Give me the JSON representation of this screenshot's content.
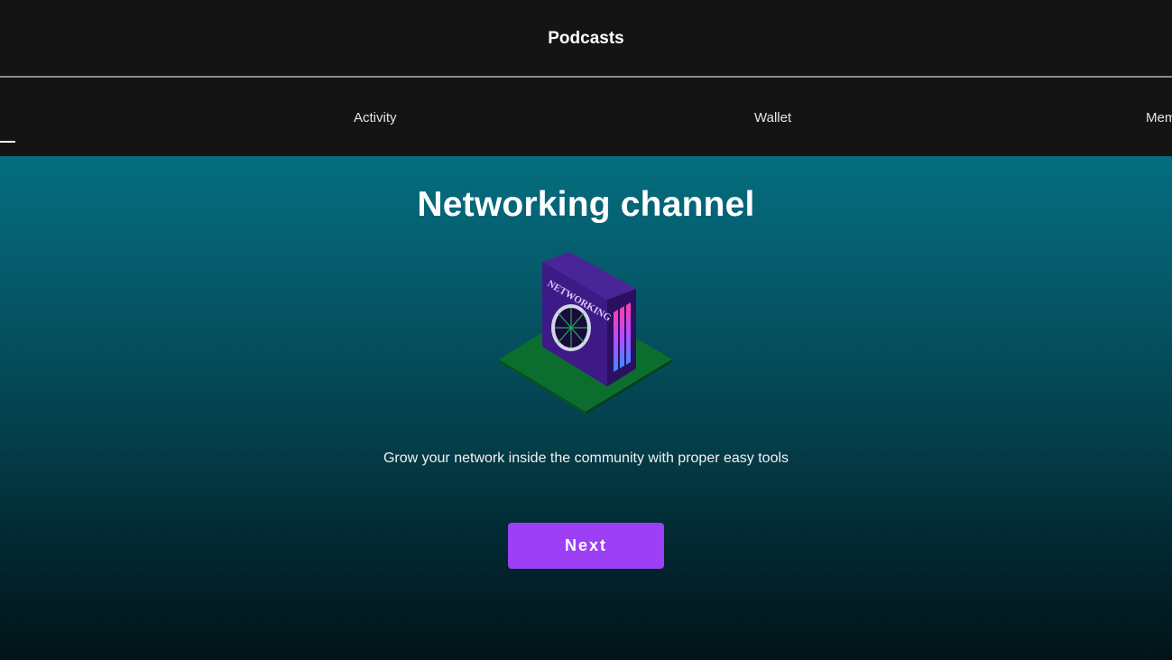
{
  "header": {
    "title": "Podcasts"
  },
  "tabs": [
    {
      "label": "Activity"
    },
    {
      "label": "Wallet"
    },
    {
      "label": "Mem"
    }
  ],
  "main": {
    "heading": "Networking channel",
    "illustration": {
      "icon": "networking-server-icon",
      "label": "NETWORKING"
    },
    "subtitle": "Grow your network inside the community with proper easy tools",
    "next_label": "Next"
  },
  "colors": {
    "header_bg": "#141414",
    "gradient_top": "#046e7e",
    "gradient_bottom": "#021419",
    "accent": "#9d3ff5",
    "server_purple": "#3d1a85",
    "base_green": "#0c6e2e"
  }
}
